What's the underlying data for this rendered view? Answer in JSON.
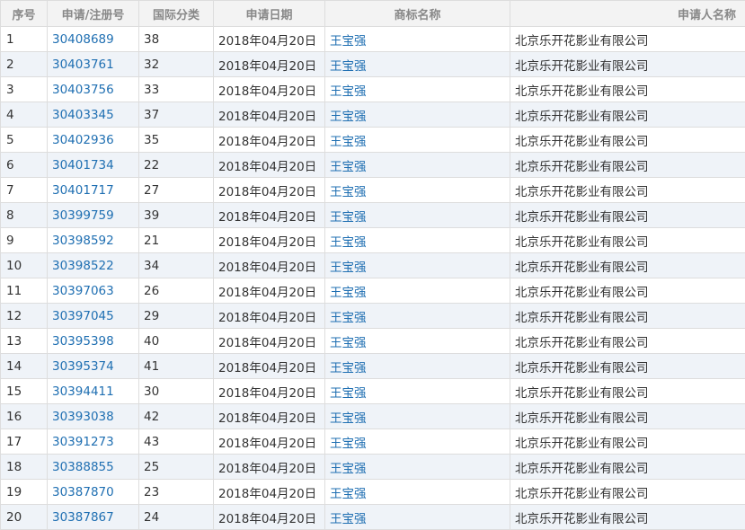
{
  "table": {
    "headers": [
      "序号",
      "申请/注册号",
      "国际分类",
      "申请日期",
      "商标名称",
      "申请人名称"
    ],
    "rows": [
      {
        "index": "1",
        "reg_no": "30408689",
        "class": "38",
        "date": "2018年04月20日",
        "name": "王宝强",
        "applicant": "北京乐开花影业有限公司"
      },
      {
        "index": "2",
        "reg_no": "30403761",
        "class": "32",
        "date": "2018年04月20日",
        "name": "王宝强",
        "applicant": "北京乐开花影业有限公司"
      },
      {
        "index": "3",
        "reg_no": "30403756",
        "class": "33",
        "date": "2018年04月20日",
        "name": "王宝强",
        "applicant": "北京乐开花影业有限公司"
      },
      {
        "index": "4",
        "reg_no": "30403345",
        "class": "37",
        "date": "2018年04月20日",
        "name": "王宝强",
        "applicant": "北京乐开花影业有限公司"
      },
      {
        "index": "5",
        "reg_no": "30402936",
        "class": "35",
        "date": "2018年04月20日",
        "name": "王宝强",
        "applicant": "北京乐开花影业有限公司"
      },
      {
        "index": "6",
        "reg_no": "30401734",
        "class": "22",
        "date": "2018年04月20日",
        "name": "王宝强",
        "applicant": "北京乐开花影业有限公司"
      },
      {
        "index": "7",
        "reg_no": "30401717",
        "class": "27",
        "date": "2018年04月20日",
        "name": "王宝强",
        "applicant": "北京乐开花影业有限公司"
      },
      {
        "index": "8",
        "reg_no": "30399759",
        "class": "39",
        "date": "2018年04月20日",
        "name": "王宝强",
        "applicant": "北京乐开花影业有限公司"
      },
      {
        "index": "9",
        "reg_no": "30398592",
        "class": "21",
        "date": "2018年04月20日",
        "name": "王宝强",
        "applicant": "北京乐开花影业有限公司"
      },
      {
        "index": "10",
        "reg_no": "30398522",
        "class": "34",
        "date": "2018年04月20日",
        "name": "王宝强",
        "applicant": "北京乐开花影业有限公司"
      },
      {
        "index": "11",
        "reg_no": "30397063",
        "class": "26",
        "date": "2018年04月20日",
        "name": "王宝强",
        "applicant": "北京乐开花影业有限公司"
      },
      {
        "index": "12",
        "reg_no": "30397045",
        "class": "29",
        "date": "2018年04月20日",
        "name": "王宝强",
        "applicant": "北京乐开花影业有限公司"
      },
      {
        "index": "13",
        "reg_no": "30395398",
        "class": "40",
        "date": "2018年04月20日",
        "name": "王宝强",
        "applicant": "北京乐开花影业有限公司"
      },
      {
        "index": "14",
        "reg_no": "30395374",
        "class": "41",
        "date": "2018年04月20日",
        "name": "王宝强",
        "applicant": "北京乐开花影业有限公司"
      },
      {
        "index": "15",
        "reg_no": "30394411",
        "class": "30",
        "date": "2018年04月20日",
        "name": "王宝强",
        "applicant": "北京乐开花影业有限公司"
      },
      {
        "index": "16",
        "reg_no": "30393038",
        "class": "42",
        "date": "2018年04月20日",
        "name": "王宝强",
        "applicant": "北京乐开花影业有限公司"
      },
      {
        "index": "17",
        "reg_no": "30391273",
        "class": "43",
        "date": "2018年04月20日",
        "name": "王宝强",
        "applicant": "北京乐开花影业有限公司"
      },
      {
        "index": "18",
        "reg_no": "30388855",
        "class": "25",
        "date": "2018年04月20日",
        "name": "王宝强",
        "applicant": "北京乐开花影业有限公司"
      },
      {
        "index": "19",
        "reg_no": "30387870",
        "class": "23",
        "date": "2018年04月20日",
        "name": "王宝强",
        "applicant": "北京乐开花影业有限公司"
      },
      {
        "index": "20",
        "reg_no": "30387867",
        "class": "24",
        "date": "2018年04月20日",
        "name": "王宝强",
        "applicant": "北京乐开花影业有限公司"
      }
    ]
  },
  "colors": {
    "link": "#1f6fb2",
    "header_bg": "#f3f3f3",
    "header_text": "#888888",
    "stripe": "#eff3f8",
    "border": "#dddddd"
  }
}
